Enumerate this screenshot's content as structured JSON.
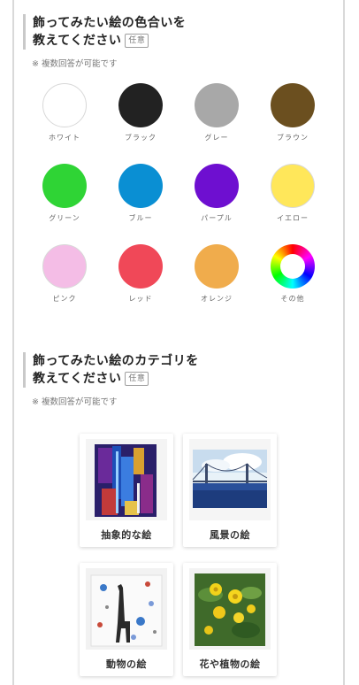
{
  "q1": {
    "title_line1": "飾ってみたい絵の色合いを",
    "title_line2": "教えてください",
    "badge": "任意",
    "note": "※ 複数回答が可能です",
    "colors": [
      {
        "label": "ホワイト",
        "color": "#ffffff"
      },
      {
        "label": "ブラック",
        "color": "#222222"
      },
      {
        "label": "グレー",
        "color": "#a8a8a8"
      },
      {
        "label": "ブラウン",
        "color": "#6b4f1f"
      },
      {
        "label": "グリーン",
        "color": "#2fd435"
      },
      {
        "label": "ブルー",
        "color": "#0a8fd3"
      },
      {
        "label": "パープル",
        "color": "#6e0fd0"
      },
      {
        "label": "イエロー",
        "color": "#ffe75a"
      },
      {
        "label": "ピンク",
        "color": "#f4bde6"
      },
      {
        "label": "レッド",
        "color": "#f04858"
      },
      {
        "label": "オレンジ",
        "color": "#f0ac4c"
      },
      {
        "label": "その他",
        "color": "rainbow"
      }
    ]
  },
  "q2": {
    "title_line1": "飾ってみたい絵のカテゴリを",
    "title_line2": "教えてください",
    "badge": "任意",
    "note": "※ 複数回答が可能です",
    "categories": [
      {
        "label": "抽象的な絵",
        "icon": "abstract-painting"
      },
      {
        "label": "風景の絵",
        "icon": "bridge-landscape-painting"
      },
      {
        "label": "動物の絵",
        "icon": "giraffe-painting"
      },
      {
        "label": "花や植物の絵",
        "icon": "yellow-flowers-painting"
      }
    ]
  }
}
